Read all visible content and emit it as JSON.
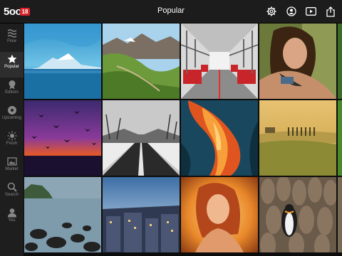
{
  "app": {
    "logo": "5oo",
    "badge": "18",
    "title": "Popular"
  },
  "toolbar": [
    {
      "name": "gear-icon"
    },
    {
      "name": "profile-icon"
    },
    {
      "name": "slideshow-icon"
    },
    {
      "name": "share-icon"
    }
  ],
  "sidebar": {
    "items": [
      {
        "label": "Flow",
        "icon": "flow-icon"
      },
      {
        "label": "Popular",
        "icon": "star-icon",
        "active": true
      },
      {
        "label": "Editors",
        "icon": "editors-icon"
      },
      {
        "label": "Upcoming",
        "icon": "upcoming-icon"
      },
      {
        "label": "Fresh",
        "icon": "fresh-icon"
      },
      {
        "label": "Market",
        "icon": "market-icon"
      },
      {
        "label": "Search",
        "icon": "search-icon"
      },
      {
        "label": "You",
        "icon": "user-icon"
      }
    ]
  },
  "photos": [
    {
      "subject": "mountain-lake"
    },
    {
      "subject": "green-valley"
    },
    {
      "subject": "train-interior"
    },
    {
      "subject": "woman-portrait"
    },
    {
      "subject": "birds-sunset"
    },
    {
      "subject": "snowy-road"
    },
    {
      "subject": "ice-cave"
    },
    {
      "subject": "golden-field"
    },
    {
      "subject": "rocky-coast"
    },
    {
      "subject": "city-rooftops"
    },
    {
      "subject": "fire-portrait"
    },
    {
      "subject": "penguins"
    }
  ]
}
